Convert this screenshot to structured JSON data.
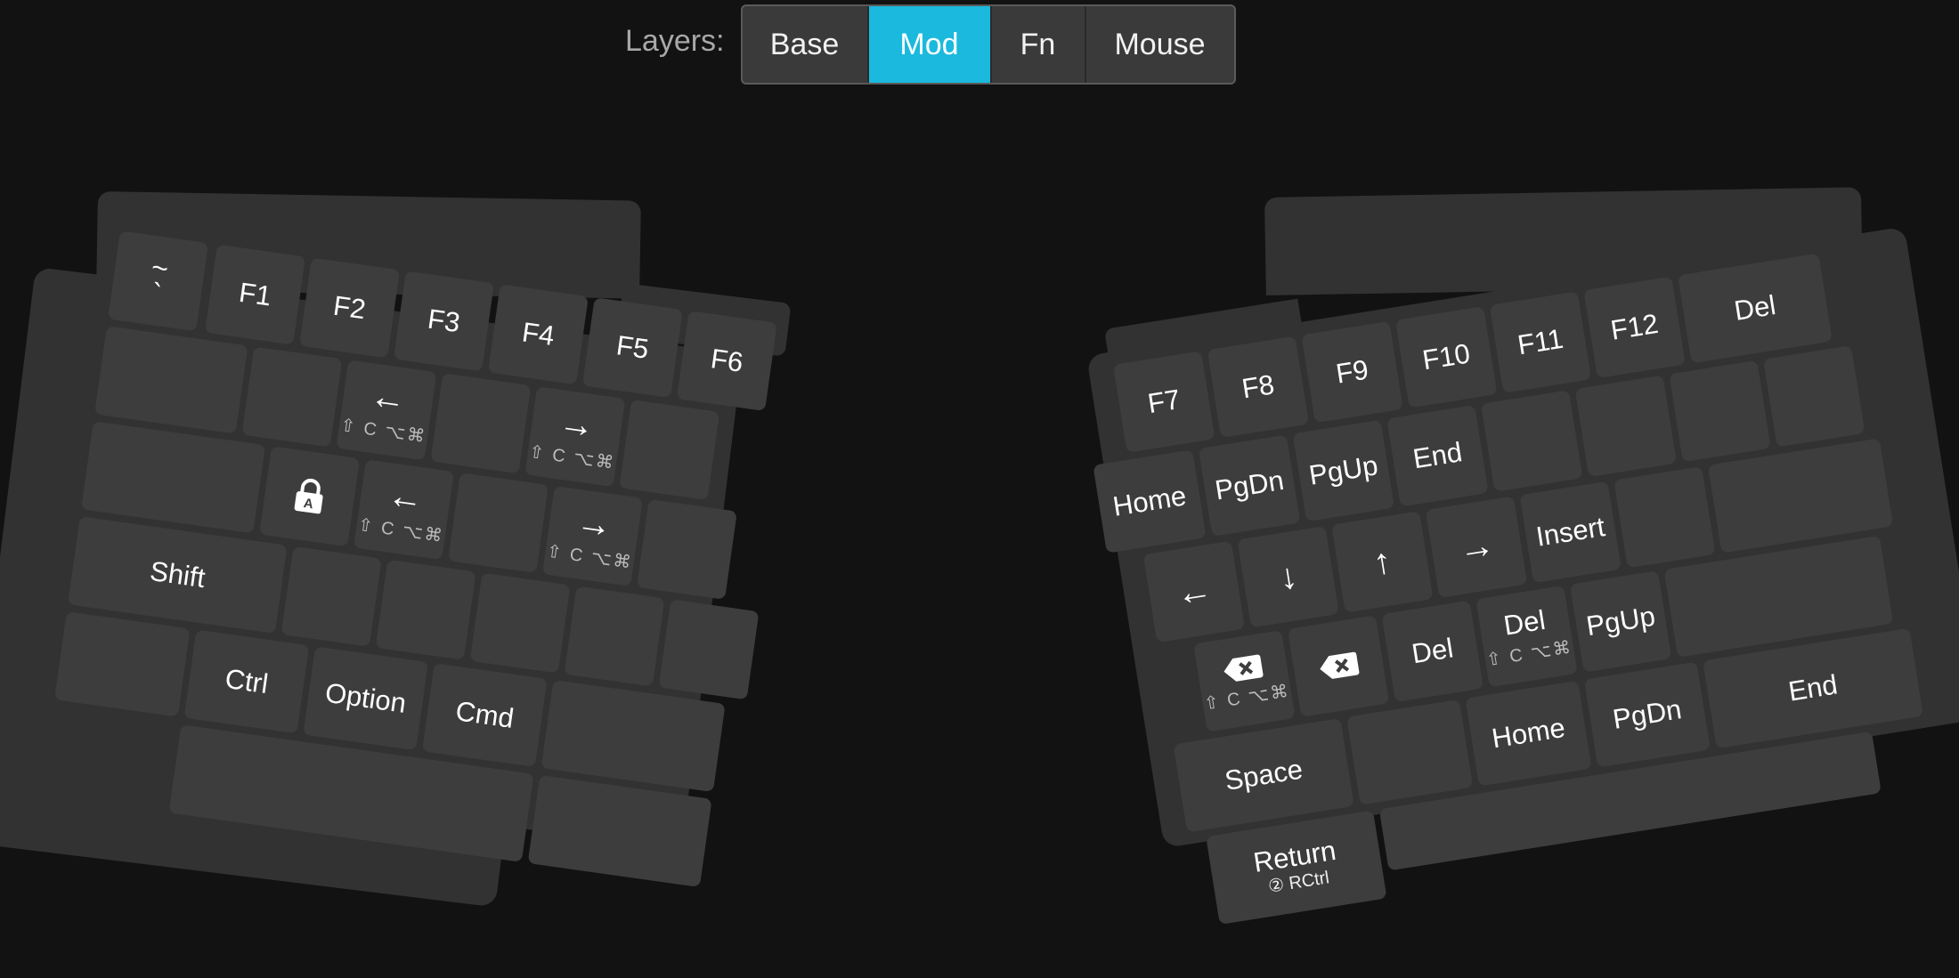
{
  "layers": {
    "label": "Layers:",
    "tabs": [
      {
        "label": "Base",
        "active": false
      },
      {
        "label": "Mod",
        "active": true
      },
      {
        "label": "Fn",
        "active": false
      },
      {
        "label": "Mouse",
        "active": false
      }
    ],
    "active_color": "#1ab9dd"
  },
  "modifier_hint": "⇧ C ⌥⌘",
  "left": {
    "row1": [
      "~",
      "`",
      "F1",
      "F2",
      "F3",
      "F4",
      "F5",
      "F6"
    ],
    "row2_arrows": {
      "left": "←",
      "right": "→"
    },
    "row3": {
      "caps_icon": "lock-a-icon",
      "left": "←",
      "right": "→"
    },
    "shift": "Shift",
    "ctrl": "Ctrl",
    "option": "Option",
    "cmd": "Cmd"
  },
  "right": {
    "row1": [
      "F7",
      "F8",
      "F9",
      "F10",
      "F11",
      "F12",
      "Del"
    ],
    "row2": [
      "Home",
      "PgDn",
      "PgUp",
      "End"
    ],
    "row3": {
      "left": "←",
      "down": "↓",
      "up": "↑",
      "right": "→",
      "insert": "Insert"
    },
    "row4": {
      "del1": "Del",
      "del2": "Del",
      "pgup": "PgUp"
    },
    "row5": {
      "home": "Home",
      "pgdn": "PgDn",
      "end": "End"
    },
    "space": "Space",
    "return": "Return",
    "return_sub": "② RCtrl"
  }
}
